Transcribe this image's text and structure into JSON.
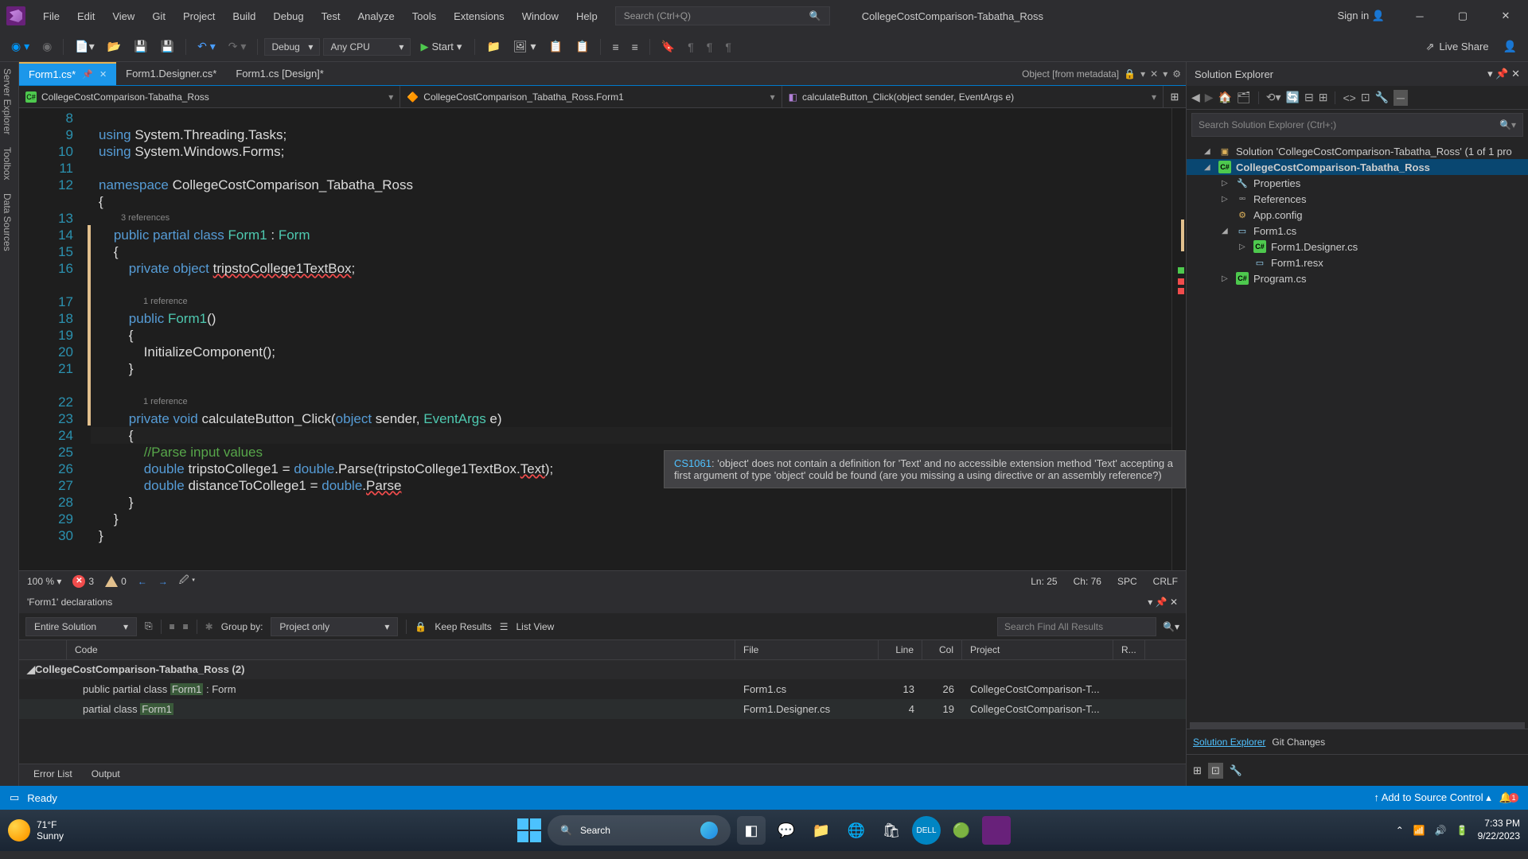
{
  "title": {
    "project": "CollegeCostComparison-Tabatha_Ross",
    "signin": "Sign in"
  },
  "menu": [
    "File",
    "Edit",
    "View",
    "Git",
    "Project",
    "Build",
    "Debug",
    "Test",
    "Analyze",
    "Tools",
    "Extensions",
    "Window",
    "Help"
  ],
  "search_placeholder": "Search (Ctrl+Q)",
  "toolbar": {
    "config": "Debug",
    "platform": "Any CPU",
    "start": "Start",
    "liveshare": "Live Share"
  },
  "left_strips": [
    "Server Explorer",
    "Toolbox",
    "Data Sources"
  ],
  "tabs": [
    {
      "label": "Form1.cs*",
      "active": true,
      "pinned": true,
      "closable": true
    },
    {
      "label": "Form1.Designer.cs*",
      "active": false
    },
    {
      "label": "Form1.cs [Design]*",
      "active": false
    }
  ],
  "tabs_right": "Object [from metadata]",
  "nav": {
    "project": "CollegeCostComparison-Tabatha_Ross",
    "class": "CollegeCostComparison_Tabatha_Ross.Form1",
    "member": "calculateButton_Click(object sender, EventArgs e)"
  },
  "code": {
    "lines": {
      "8": "using System.Threading.Tasks;",
      "9": "using System.Windows.Forms;",
      "11_ns": "namespace",
      "11_id": "CollegeCostComparison_Tabatha_Ross",
      "ref3": "3 references",
      "13": "public partial class Form1 : Form",
      "15": "private object tripstoCollege1TextBox;",
      "ref1a": "1 reference",
      "17": "public Form1()",
      "19": "InitializeComponent();",
      "ref1b": "1 reference",
      "22": "private void calculateButton_Click(object sender, EventArgs e)",
      "24": "//Parse input values",
      "25": "double tripstoCollege1 = double.Parse(tripstoCollege1TextBox.Text);",
      "26": "double distanceToCollege1 = double.Parse"
    },
    "line_numbers": [
      "8",
      "9",
      "10",
      "11",
      "12",
      "",
      "13",
      "14",
      "15",
      "16",
      "",
      "17",
      "18",
      "19",
      "20",
      "21",
      "",
      "22",
      "23",
      "24",
      "25",
      "26",
      "27",
      "28",
      "29",
      "30"
    ]
  },
  "tooltip": {
    "code": "CS1061",
    "msg": ": 'object' does not contain a definition for 'Text' and no accessible extension method 'Text' accepting a first argument of type 'object' could be found (are you missing a using directive or an assembly reference?)"
  },
  "editor_status": {
    "zoom": "100 %",
    "errors": "3",
    "warnings": "0",
    "line": "Ln: 25",
    "col": "Ch: 76",
    "spc": "SPC",
    "eol": "CRLF"
  },
  "bottom": {
    "title": "'Form1' declarations",
    "scope": "Entire Solution",
    "groupby_label": "Group by:",
    "groupby": "Project only",
    "keepresults": "Keep Results",
    "listview": "List View",
    "search_placeholder": "Search Find All Results",
    "cols": {
      "code": "Code",
      "file": "File",
      "line": "Line",
      "col": "Col",
      "project": "Project",
      "r": "R..."
    },
    "group": "CollegeCostComparison-Tabatha_Ross  (2)",
    "rows": [
      {
        "pre": "public partial class ",
        "hl": "Form1",
        "post": " : Form",
        "file": "Form1.cs",
        "line": "13",
        "col": "26",
        "proj": "CollegeCostComparison-T..."
      },
      {
        "pre": "partial class ",
        "hl": "Form1",
        "post": "",
        "file": "Form1.Designer.cs",
        "line": "4",
        "col": "19",
        "proj": "CollegeCostComparison-T..."
      }
    ],
    "tabs": [
      "Error List",
      "Output"
    ]
  },
  "se": {
    "title": "Solution Explorer",
    "search_placeholder": "Search Solution Explorer (Ctrl+;)",
    "solution": "Solution 'CollegeCostComparison-Tabatha_Ross' (1 of 1 pro",
    "project": "CollegeCostComparison-Tabatha_Ross",
    "items": {
      "props": "Properties",
      "refs": "References",
      "cfg": "App.config",
      "form": "Form1.cs",
      "designer": "Form1.Designer.cs",
      "resx": "Form1.resx",
      "program": "Program.cs"
    },
    "bottom_tabs": [
      "Solution Explorer",
      "Git Changes"
    ]
  },
  "status": {
    "ready": "Ready",
    "sourcecontrol": "Add to Source Control",
    "notif": "1"
  },
  "taskbar": {
    "temp": "71°F",
    "cond": "Sunny",
    "search": "Search",
    "time": "7:33 PM",
    "date": "9/22/2023"
  }
}
